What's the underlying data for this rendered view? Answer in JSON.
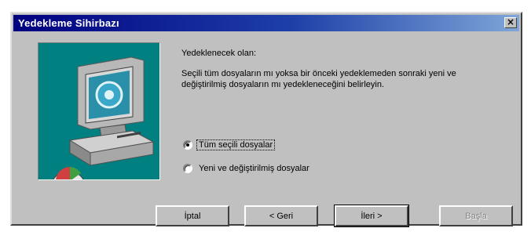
{
  "window": {
    "title": "Yedekleme Sihirbazı",
    "close_glyph": "×"
  },
  "content": {
    "heading": "Yedeklenecek olan:",
    "description": "Seçili tüm dosyaların mı yoksa bir önceki yedeklemeden sonraki yeni ve değiştirilmiş dosyaların mı yedekleneceğini belirleyin."
  },
  "options": [
    {
      "label": "Tüm seçili dosyalar",
      "selected": true
    },
    {
      "label": "Yeni ve değiştirilmiş dosyalar",
      "selected": false
    }
  ],
  "buttons": {
    "cancel": "İptal",
    "back": "< Geri",
    "next": "İleri >",
    "finish": "Başla"
  },
  "colors": {
    "titlebar": "#000080",
    "panel": "#008080",
    "face": "#c0c0c0"
  },
  "illustration": {
    "icon": "computer-backup-icon"
  }
}
